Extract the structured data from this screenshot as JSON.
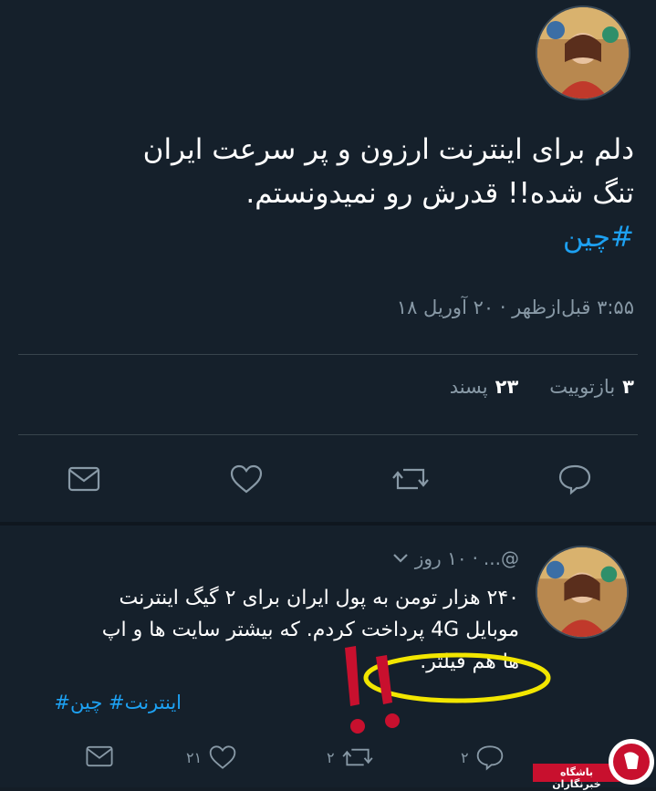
{
  "tweet": {
    "header_text": "",
    "body_line1": "دلم برای اینترنت ارزون و پر سرعت ایران",
    "body_line2": "تنگ شده!! قدرش رو نمیدونستم.",
    "hashtag": "#چین",
    "timestamp": "۳:۵۵ قبل‌ازظهر · ۲۰ آوریل ۱۸",
    "retweets_count": "۳",
    "retweets_label": "بازتوییت",
    "likes_count": "۲۳",
    "likes_label": "پسند"
  },
  "actions": [
    "reply-icon",
    "retweet-icon",
    "like-icon",
    "mail-icon"
  ],
  "reply": {
    "handle": "@...",
    "time": "۱۰ روز",
    "line1": "۲۴۰ هزار تومن به پول ایران برای ۲ گیگ اینترنت",
    "line2": "موبایل 4G پرداخت کردم. که بیشتر سایت ها و اپ",
    "line3": "ها هم فیلتر.",
    "hashtags": "اینترنت# چین#",
    "reply_count": "۲",
    "retweet_count": "۲",
    "like_count": "۲۱"
  },
  "watermark": {
    "text": "باشگاه خبرنگاران"
  },
  "colors": {
    "background": "#15202b",
    "link": "#1da1f2",
    "muted": "#8899a6",
    "highlight": "#f2e600",
    "exclaim": "#c8102e"
  }
}
